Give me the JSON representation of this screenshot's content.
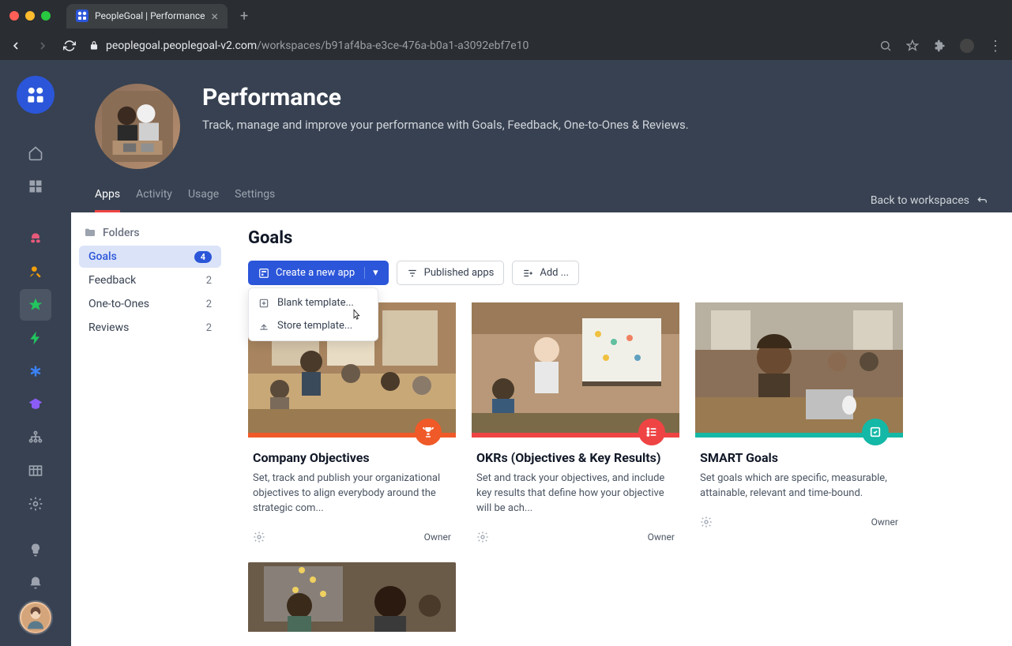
{
  "browser": {
    "tab_title": "PeopleGoal | Performance",
    "url_host": "peoplegoal.peoplegoal-v2.com",
    "url_path": "/workspaces/b91af4ba-e3ce-476a-b0a1-a3092ebf7e10"
  },
  "workspace": {
    "title": "Performance",
    "subtitle": "Track, manage and improve your performance with Goals, Feedback, One-to-Ones & Reviews."
  },
  "nav_tabs": {
    "apps": "Apps",
    "activity": "Activity",
    "usage": "Usage",
    "settings": "Settings",
    "back": "Back to workspaces"
  },
  "sidebar": {
    "folders_label": "Folders",
    "items": [
      {
        "label": "Goals",
        "count": "4",
        "active": true
      },
      {
        "label": "Feedback",
        "count": "2",
        "active": false
      },
      {
        "label": "One-to-Ones",
        "count": "2",
        "active": false
      },
      {
        "label": "Reviews",
        "count": "2",
        "active": false
      }
    ]
  },
  "main": {
    "title": "Goals",
    "create_btn": "Create a new app",
    "published_btn": "Published apps",
    "add_btn": "Add ...",
    "dropdown": {
      "blank": "Blank template...",
      "store": "Store template..."
    }
  },
  "cards": [
    {
      "title": "Company Objectives",
      "desc": "Set, track and publish your organizational objectives to align everybody around the strategic com...",
      "role": "Owner",
      "accent": "#f05a28",
      "icon": "trophy"
    },
    {
      "title": "OKRs (Objectives & Key Results)",
      "desc": "Set and track your objectives, and include key results that define how your objective will be ach...",
      "role": "Owner",
      "accent": "#ef4444",
      "icon": "list"
    },
    {
      "title": "SMART Goals",
      "desc": "Set goals which are specific, measurable, attainable, relevant and time-bound.",
      "role": "Owner",
      "accent": "#14b8a6",
      "icon": "check"
    }
  ]
}
